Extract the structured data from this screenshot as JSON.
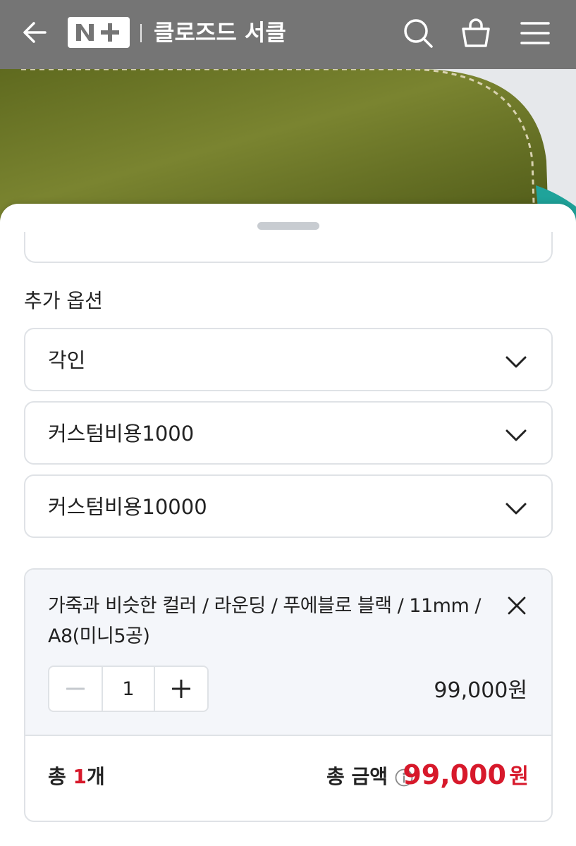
{
  "header": {
    "logo_text": "N+",
    "store_name": "클로즈드 서클"
  },
  "options": {
    "section_title": "추가 옵션",
    "selects": [
      {
        "label": "각인"
      },
      {
        "label": "커스텀비용1000"
      },
      {
        "label": "커스텀비용10000"
      }
    ]
  },
  "selected_item": {
    "name": "가죽과 비슷한 컬러 / 라운딩 / 푸에블로 블랙 / 11mm / A8(미니5공)",
    "quantity": "1",
    "price": "99,000원"
  },
  "total": {
    "count_prefix": "총 ",
    "count_value": "1",
    "count_suffix": "개",
    "amount_label": "총 금액",
    "amount_value": "99,000",
    "amount_unit": "원"
  },
  "colors": {
    "header_bg": "#757575",
    "accent_red": "#d7192b",
    "border": "#dfe2e6",
    "card_bg": "#f4f6fa"
  },
  "icons": [
    "back-arrow-icon",
    "search-icon",
    "shopping-bag-icon",
    "menu-icon",
    "chevron-down-icon",
    "close-icon",
    "minus-icon",
    "plus-icon",
    "info-icon"
  ]
}
